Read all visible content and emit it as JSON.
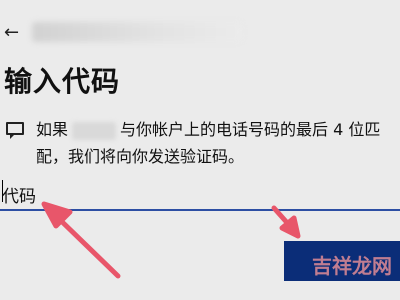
{
  "header": {
    "back_icon": "arrow-left-icon",
    "title": "输入代码"
  },
  "message": {
    "icon": "chat-bubble-icon",
    "line1_part1": "如果",
    "line1_part2": "与你帐户上的电话号码的最后 4 位匹",
    "line2": "配，我们将向你发送验证码。"
  },
  "code_input": {
    "label": "代码",
    "value": ""
  },
  "watermark": {
    "text": "吉祥龙网"
  },
  "colors": {
    "accent": "#0b2d78",
    "underline": "#2c4ea3",
    "arrow": "#e8566a",
    "watermark": "#e08b96"
  }
}
